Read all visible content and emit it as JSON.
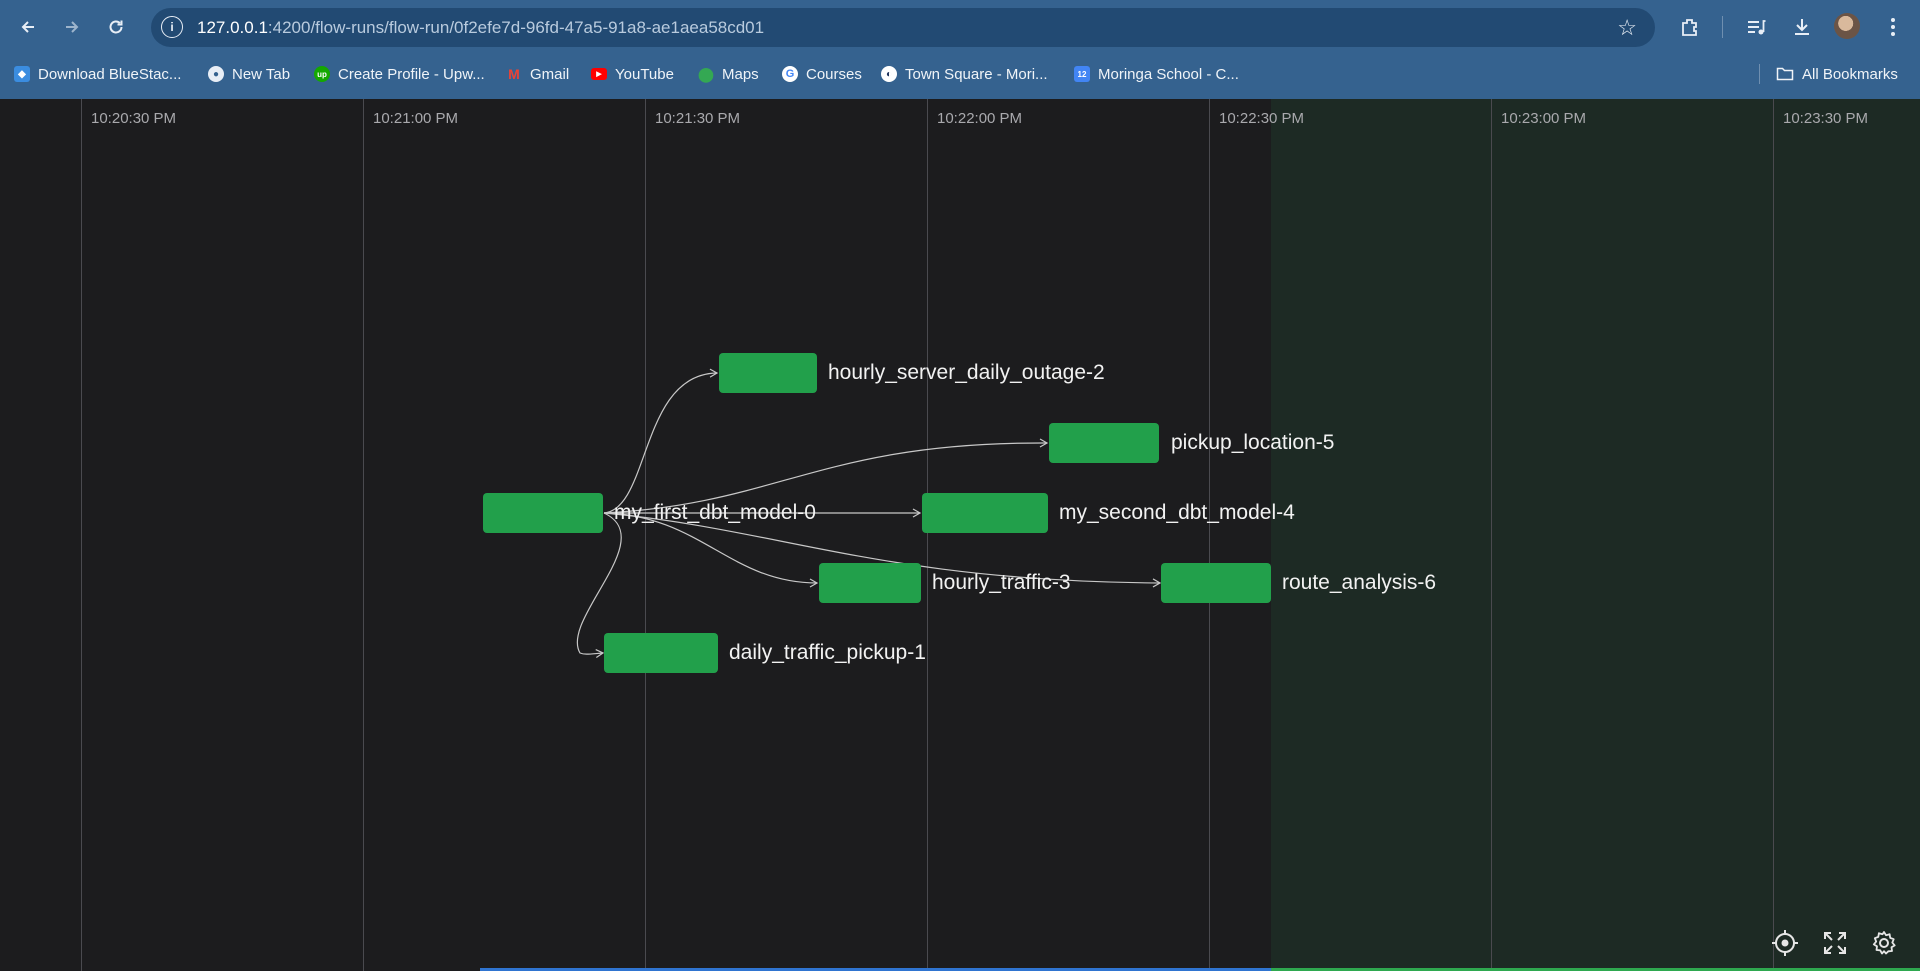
{
  "browser": {
    "url_host": "127.0.0.1",
    "url_rest": ":4200/flow-runs/flow-run/0f2efe7d-96fd-47a5-91a8-ae1aea58cd01",
    "bookmarks": [
      {
        "label": "Download BlueStac...",
        "icon": "bluestacks-icon",
        "color": "#3b8de0"
      },
      {
        "label": "New Tab",
        "icon": "globe-icon",
        "color": "#e8eef6"
      },
      {
        "label": "Create Profile - Upw...",
        "icon": "upwork-icon",
        "color": "#14a800"
      },
      {
        "label": "Gmail",
        "icon": "gmail-icon",
        "color": "#ea4335"
      },
      {
        "label": "YouTube",
        "icon": "youtube-icon",
        "color": "#ff0000"
      },
      {
        "label": "Maps",
        "icon": "maps-icon",
        "color": "#34a853"
      },
      {
        "label": "Courses",
        "icon": "google-icon",
        "color": "#ffffff"
      },
      {
        "label": "Town Square - Mori...",
        "icon": "mattermost-icon",
        "color": "#ffffff"
      },
      {
        "label": "Moringa School - C...",
        "icon": "calendar-icon",
        "color": "#4285f4"
      }
    ],
    "all_bookmarks": "All Bookmarks"
  },
  "timeline": {
    "ticks": [
      "10:20:30 PM",
      "10:21:00 PM",
      "10:21:30 PM",
      "10:22:00 PM",
      "10:22:30 PM",
      "10:23:00 PM",
      "10:23:30 PM"
    ],
    "colors": {
      "node": "#22a04b",
      "future_shade": "#1d2a24",
      "edge": "#c8c8c8"
    }
  },
  "nodes": [
    {
      "id": "n0",
      "label": "my_first_dbt_model-0"
    },
    {
      "id": "n1",
      "label": "daily_traffic_pickup-1"
    },
    {
      "id": "n2",
      "label": "hourly_server_daily_outage-2"
    },
    {
      "id": "n3",
      "label": "hourly_traffic-3"
    },
    {
      "id": "n4",
      "label": "my_second_dbt_model-4"
    },
    {
      "id": "n5",
      "label": "pickup_location-5"
    },
    {
      "id": "n6",
      "label": "route_analysis-6"
    }
  ],
  "controls": {
    "recenter": "crosshair-icon",
    "fullscreen": "fullscreen-icon",
    "settings": "gear-icon"
  }
}
